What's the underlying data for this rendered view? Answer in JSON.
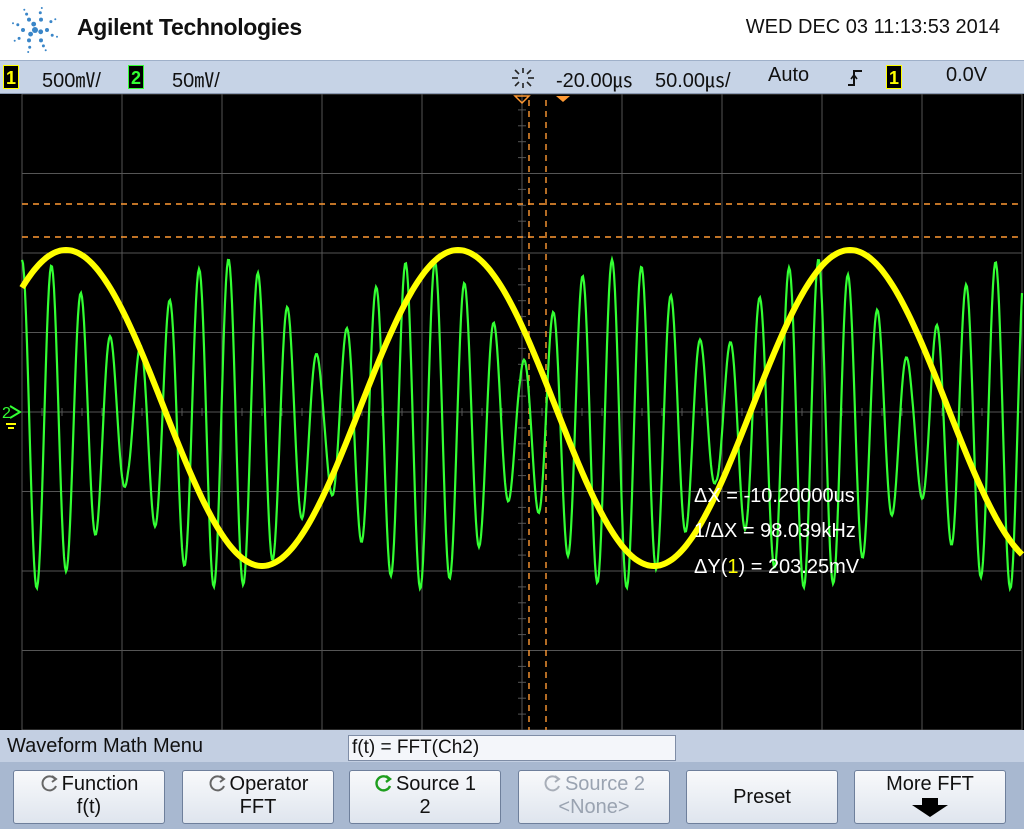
{
  "header": {
    "brand": "Agilent Technologies",
    "datetime": "WED DEC 03 11:13:53 2014"
  },
  "status": {
    "ch1_num": "1",
    "ch1_scale": "500㎷/",
    "ch2_num": "2",
    "ch2_scale": "50㎷/",
    "time_delay": "-20.00㎲",
    "time_scale": "50.00㎲/",
    "trigger_mode": "Auto",
    "trigger_slope": "rising-edge-icon",
    "trigger_source": "1",
    "trigger_level": "0.0V",
    "colors": {
      "ch1": "#ffff00",
      "ch2": "#33ff33",
      "cursor": "#ff9933"
    }
  },
  "channel_marker": "2",
  "readouts": {
    "dx": "ΔX = -10.20000us",
    "inv_dx": "1/ΔX = 98.039kHz",
    "dy_prefix": "ΔY(",
    "dy_channel": "1",
    "dy_suffix": ") = 203.25mV"
  },
  "menu": {
    "title": "Waveform Math Menu",
    "formula": "f(t) = FFT(Ch2)"
  },
  "softkeys": [
    {
      "label": "Function",
      "value": "f(t)"
    },
    {
      "label": "Operator",
      "value": "FFT"
    },
    {
      "label": "Source 1",
      "value": "2"
    },
    {
      "label": "Source 2",
      "value": "<None>"
    },
    {
      "label": "Preset",
      "value": ""
    },
    {
      "label": "More FFT",
      "value": "down-arrow-icon"
    }
  ]
}
